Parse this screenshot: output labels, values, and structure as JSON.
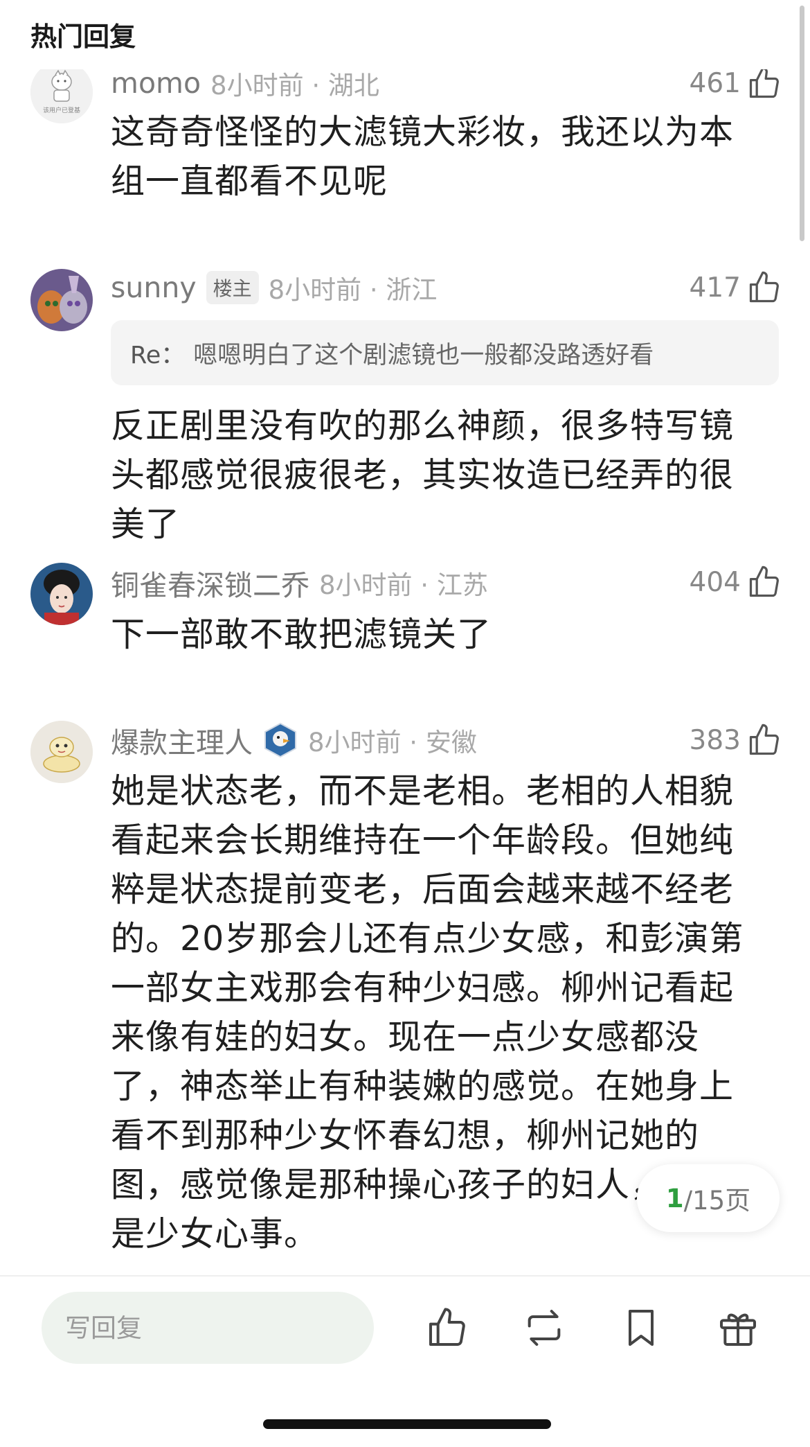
{
  "header": {
    "title": "热门回复"
  },
  "comments": [
    {
      "username": "momo",
      "time_location": "8小时前 · 湖北",
      "likes": "461",
      "body": "这奇奇怪怪的大滤镜大彩妆，我还以为本组一直都看不见呢",
      "avatar_text": "该用户已登基"
    },
    {
      "username": "sunny",
      "op_badge": "楼主",
      "time_location": "8小时前 · 浙江",
      "likes": "417",
      "reply_label": "Re：",
      "reply_text": "嗯嗯明白了这个剧滤镜也一般都没路透好看",
      "body": "反正剧里没有吹的那么神颜，很多特写镜头都感觉很疲很老，其实妆造已经弄的很美了"
    },
    {
      "username": "铜雀春深锁二乔",
      "time_location": "8小时前 · 江苏",
      "likes": "404",
      "body": "下一部敢不敢把滤镜关了"
    },
    {
      "username": "爆款主理人",
      "time_location": "8小时前 · 安徽",
      "likes": "383",
      "body": "她是状态老，而不是老相。老相的人相貌看起来会长期维持在一个年龄段。但她纯粹是状态提前变老，后面会越来越不经老的。20岁那会儿还有点少女感，和彭演第一部女主戏那会有种少妇感。柳州记看起来像有娃的妇女。现在一点少女感都没了，神态举止有种装嫩的感觉。在她身上看不到那种少女怀春幻想，柳州记她的图，感觉像是那种操心孩子的妇人，而不是少女心事。"
    }
  ],
  "pagination": {
    "current": "1",
    "total": "/15页"
  },
  "bottom_bar": {
    "reply_placeholder": "写回复",
    "actions": [
      "thumbs-up-icon",
      "repost-icon",
      "bookmark-icon",
      "gift-icon"
    ]
  },
  "colors": {
    "accent_green": "#2e9e3f",
    "text_gray": "#a8a8a8"
  }
}
